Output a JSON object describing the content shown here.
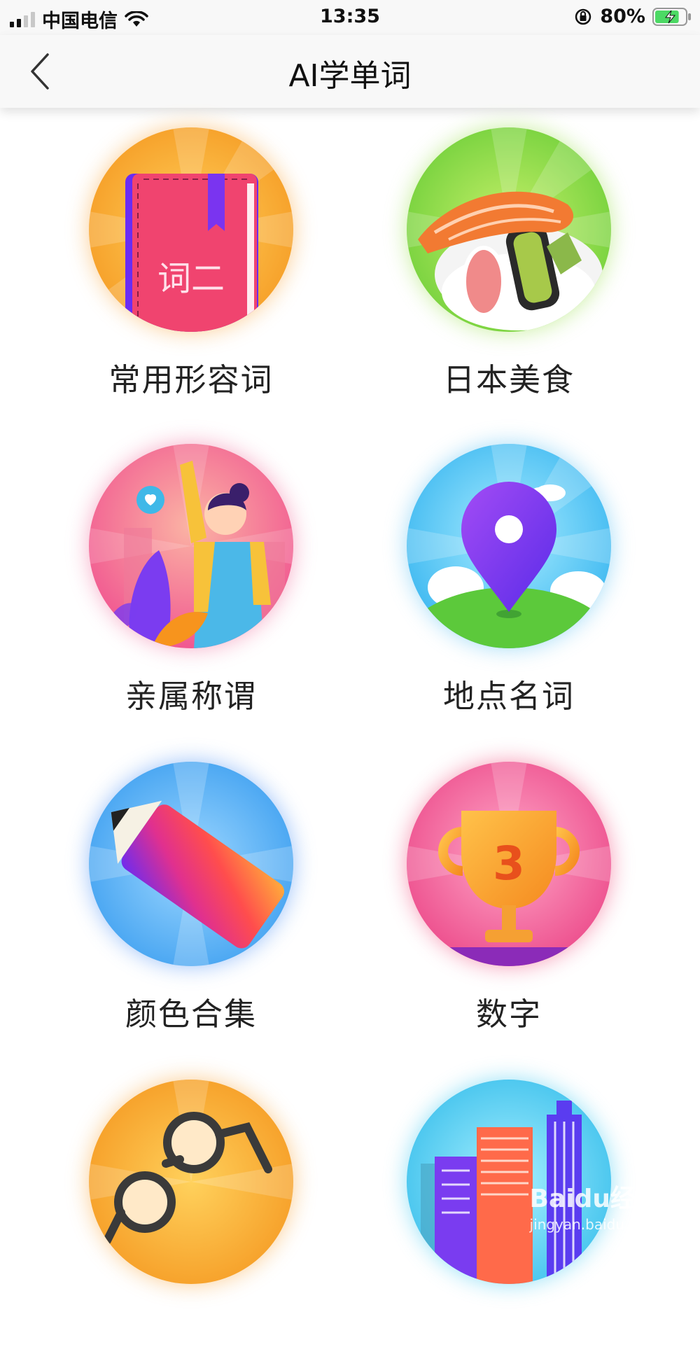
{
  "status_bar": {
    "carrier": "中国电信",
    "time": "13:35",
    "battery_percent": "80%",
    "battery_level": 0.8,
    "signal_bars": 2
  },
  "nav": {
    "title": "AI学单词",
    "back_icon": "chevron-left-icon"
  },
  "categories": [
    {
      "label": "常用形容词",
      "illustration": "book-icon",
      "bg": "#f7b733"
    },
    {
      "label": "日本美食",
      "illustration": "sushi-icon",
      "bg": "#8fd84a"
    },
    {
      "label": "亲属称谓",
      "illustration": "person-waving-icon",
      "bg": "#f27fa6"
    },
    {
      "label": "地点名词",
      "illustration": "location-pin-icon",
      "bg": "#5cc9f5"
    },
    {
      "label": "颜色合集",
      "illustration": "pencil-icon",
      "bg": "#5ab9f0"
    },
    {
      "label": "数字",
      "illustration": "trophy-icon",
      "bg": "#f06aa6"
    },
    {
      "label": "",
      "illustration": "glasses-icon",
      "bg": "#f7b733"
    },
    {
      "label": "",
      "illustration": "buildings-icon",
      "bg": "#4fd0f0"
    }
  ],
  "trophy_number": "3",
  "book_text": "词二",
  "watermark": {
    "brand": "Baidu经验",
    "domain": "jingyan.baidu.com"
  }
}
